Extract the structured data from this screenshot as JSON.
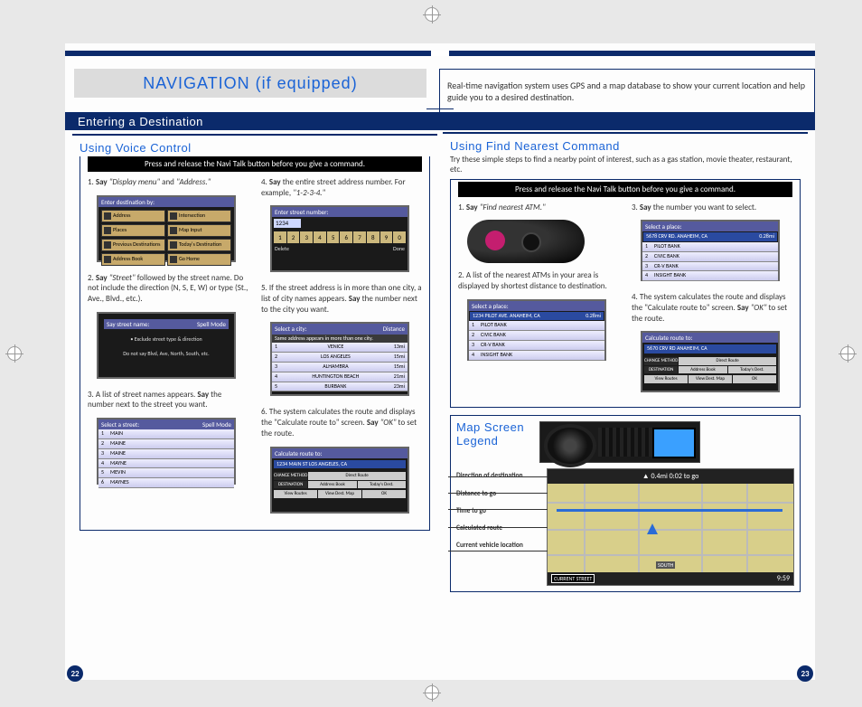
{
  "page": {
    "title": "NAVIGATION (if equipped)",
    "description": "Real-time navigation system uses GPS and a map database to show your current location and help guide you to a desired destination.",
    "section_header": "Entering a Destination",
    "page_left": "22",
    "page_right": "23"
  },
  "voice": {
    "heading": "Using Voice Control",
    "black_strip": "Press and release the Navi Talk button before you give a command.",
    "steps_left": [
      {
        "n": "1.",
        "pre": "Say",
        "em": " \"Display menu\"",
        "mid": " and ",
        "em2": "\"Address.\""
      },
      {
        "n": "2.",
        "pre": "Say",
        "em": " \"Street\"",
        "mid": " followed by the street name. Do not include the direction (N, S, E, W) or type (St., Ave., Blvd., etc.).",
        "em2": ""
      },
      {
        "n": "3.",
        "plain": "A list of street names appears. ",
        "pre": "Say",
        "mid": " the number next to the street you want."
      }
    ],
    "steps_right": [
      {
        "n": "4.",
        "pre": "Say",
        "mid": " the entire street address number. For example, ",
        "em": "\"1-2-3-4.\""
      },
      {
        "n": "5.",
        "plain": "If the street address is in more than one city, a list of city names appears. ",
        "pre": "Say",
        "mid": " the number next to the city you want."
      },
      {
        "n": "6.",
        "plain": "The system calculates the route and displays the \"Calculate route to\" screen. ",
        "pre": "Say",
        "em": " \"OK\"",
        "mid": " to set the route."
      }
    ],
    "dest_menu": {
      "header": "Enter destination by:",
      "buttons": [
        "Address",
        "Intersection",
        "Places",
        "Map Input",
        "Previous Destinations",
        "Today's Destination",
        "Address Book",
        "Go Home"
      ]
    },
    "numpad": {
      "header": "Enter street number:",
      "value": "1234",
      "keys": [
        "1",
        "2",
        "3",
        "4",
        "5",
        "6",
        "7",
        "8",
        "9",
        "0"
      ],
      "delete": "Delete",
      "done": "Done"
    },
    "say_street": {
      "header": "Say street name:",
      "mode": "Spell Mode",
      "msg1": "• Exclude street type & direction",
      "msg2": "Do not say Blvd, Ave, North, South, etc."
    },
    "city_list": {
      "header": "Select a city:",
      "sort": "Distance",
      "sub": "Same address appears in more than one city.",
      "rows": [
        [
          "1",
          "VENICE",
          "13mi"
        ],
        [
          "2",
          "LOS ANGELES",
          "15mi"
        ],
        [
          "3",
          "ALHAMBRA",
          "15mi"
        ],
        [
          "4",
          "HUNTINGTON BEACH",
          "21mi"
        ],
        [
          "5",
          "BURBANK",
          "23mi"
        ]
      ]
    },
    "street_list": {
      "header": "Select a street:",
      "mode": "Spell Mode",
      "rows": [
        [
          "1",
          "MAIN"
        ],
        [
          "2",
          "MAINE"
        ],
        [
          "3",
          "MAINE"
        ],
        [
          "4",
          "MAYNE"
        ],
        [
          "5",
          "MEVIN"
        ],
        [
          "6",
          "MAYNES"
        ]
      ]
    },
    "calc_route": {
      "header": "Calculate route to:",
      "dest": "1234 MAIN ST\nLOS ANGELES, CA",
      "opts": [
        "CHANGE METHOD",
        "Direct Route",
        "DESTINATION",
        "Address Book",
        "Today's Dest."
      ],
      "bottom": [
        "View Routes",
        "View Dest. Map",
        "OK"
      ]
    }
  },
  "find": {
    "heading": "Using Find Nearest Command",
    "intro": "Try these simple steps to find a nearby point of interest, such as a gas station, movie theater, restaurant, etc.",
    "black_strip": "Press and release the Navi Talk button before you give a command.",
    "steps_left": [
      {
        "n": "1.",
        "pre": "Say",
        "em": " \"Find nearest ATM.\""
      },
      {
        "n": "2.",
        "plain": "A list of the nearest ATMs in your area is displayed by shortest distance to destination."
      }
    ],
    "steps_right": [
      {
        "n": "3.",
        "pre": "Say",
        "mid": " the number you want to select."
      },
      {
        "n": "4.",
        "plain": "The system calculates the route and displays the \"Calculate route to\" screen. ",
        "pre": "Say",
        "em": " \"OK\"",
        "mid": " to set the route."
      }
    ],
    "place_list": {
      "header": "Select a place:",
      "sel": [
        "1234 PILOT AVE. ANAHEIM, CA",
        "0.28mi"
      ],
      "rows": [
        [
          "1",
          "PILOT BANK"
        ],
        [
          "2",
          "CIVIC BANK"
        ],
        [
          "3",
          "CR-V BANK"
        ],
        [
          "4",
          "INSIGHT BANK"
        ]
      ]
    },
    "place_list2": {
      "header": "Select a place:",
      "sel": [
        "5678 CRV RD. ANAHEIM, CA",
        "0.28mi"
      ],
      "rows": [
        [
          "1",
          "PILOT BANK"
        ],
        [
          "2",
          "CIVIC BANK"
        ],
        [
          "3",
          "CR-V BANK"
        ],
        [
          "4",
          "INSIGHT BANK"
        ]
      ]
    },
    "calc_route": {
      "header": "Calculate route to:",
      "dest": "5670 CRV RD\nANAHEIM, CA",
      "opts": [
        "CHANGE METHOD",
        "Direct Route",
        "DESTINATION",
        "Address Book",
        "Today's Dest."
      ],
      "bottom": [
        "View Routes",
        "View Dest. Map",
        "OK"
      ]
    }
  },
  "legend": {
    "title": "Map Screen Legend",
    "items": [
      "Direction of destination",
      "Distance to go",
      "Time to go",
      "Calculated route",
      "Current vehicle location"
    ],
    "top_strip": "▲   0.4mi   0:02 to go",
    "bot_left": "CURRENT STREET",
    "bot_right": "9:59",
    "south": "SOUTH"
  }
}
